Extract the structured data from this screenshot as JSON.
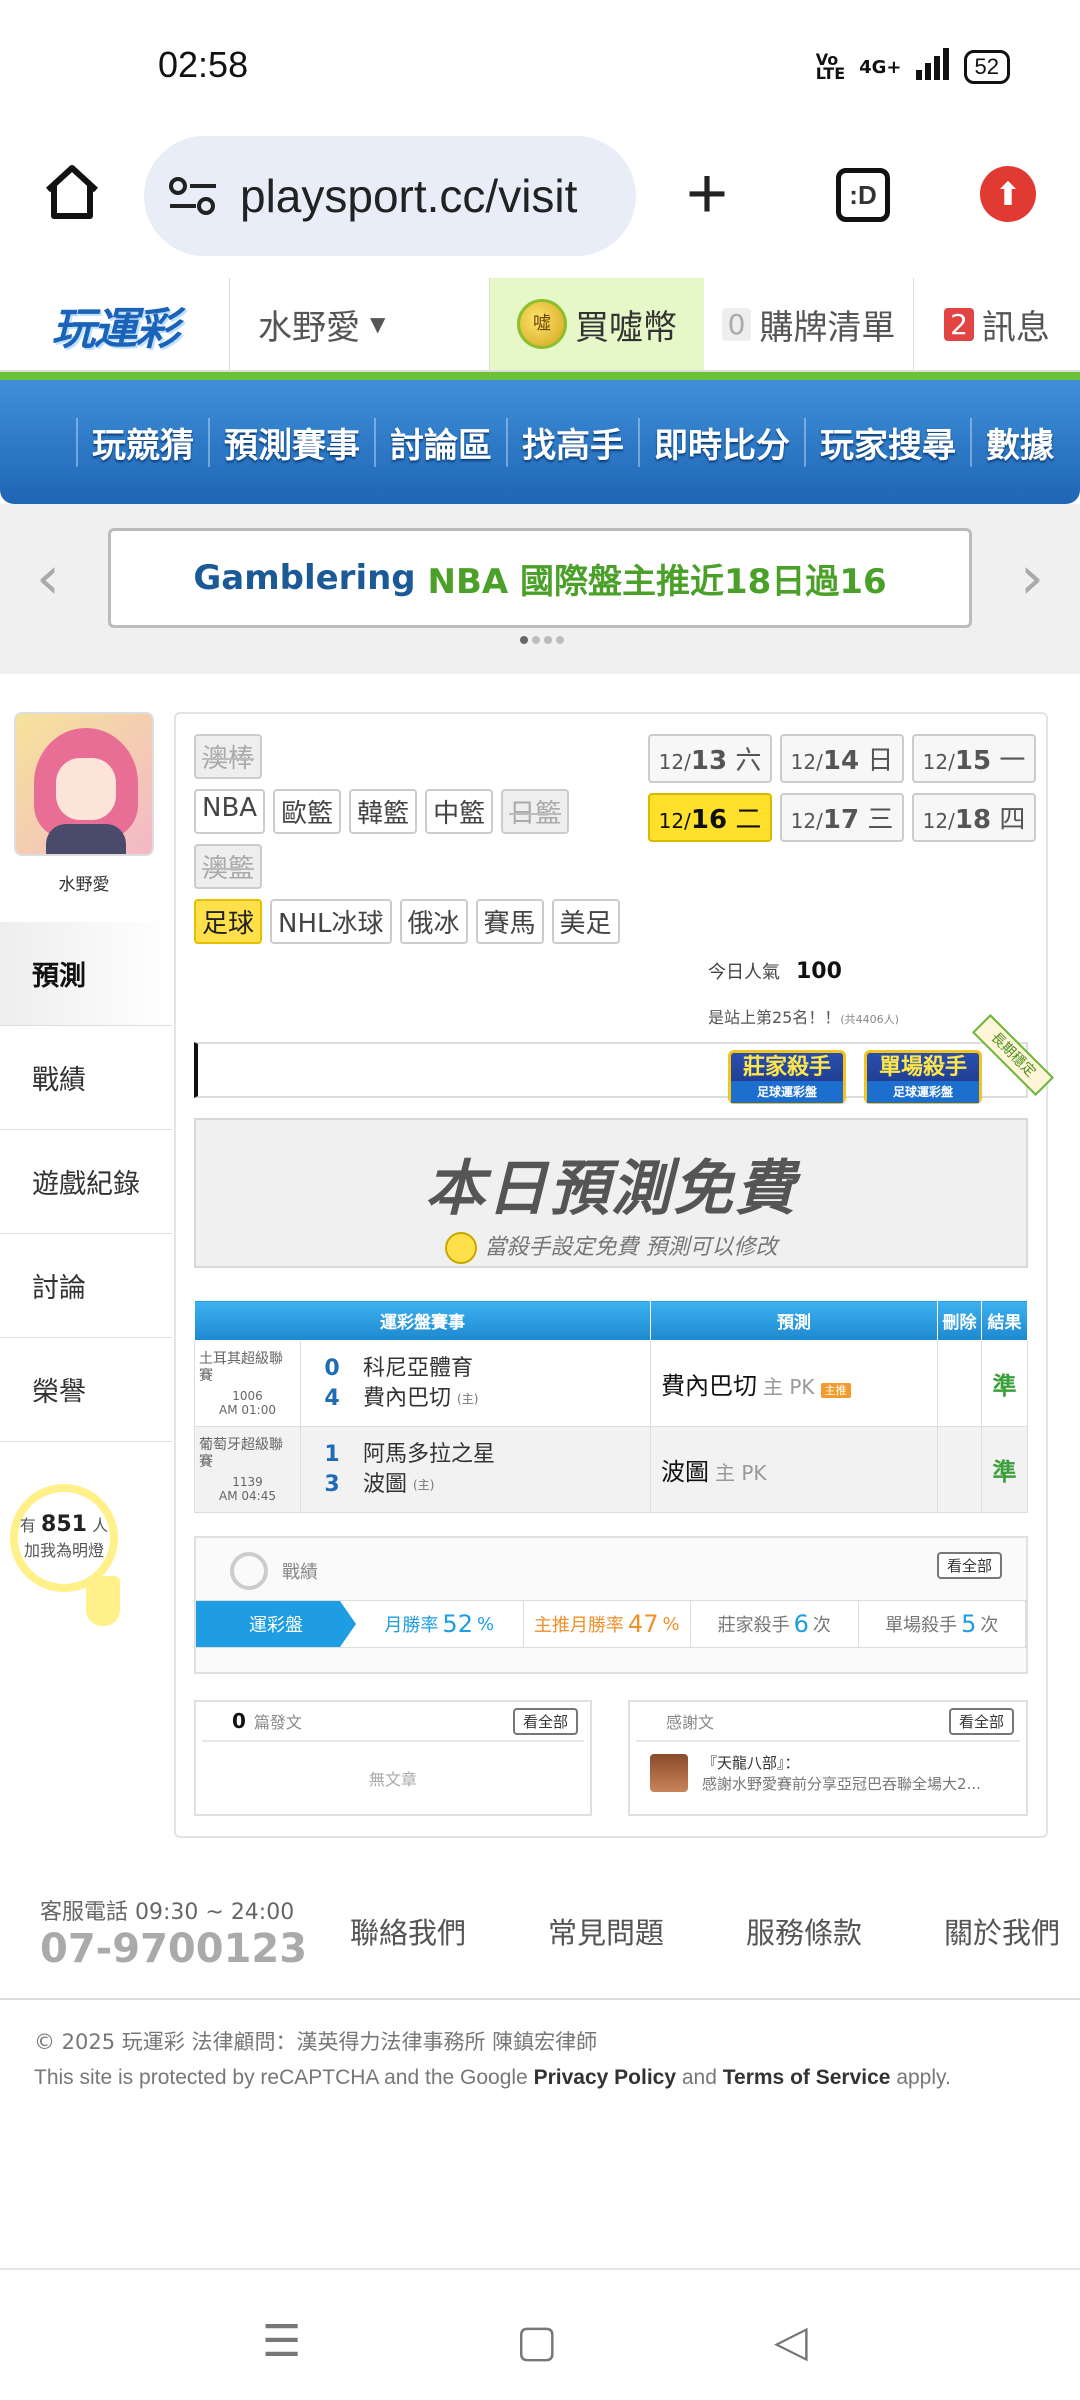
{
  "status": {
    "time": "02:58",
    "network": "4G+",
    "battery": "52"
  },
  "browser": {
    "url": "playsport.cc/visit",
    "tabs_label": ":D"
  },
  "header": {
    "logo": "玩運彩",
    "username": "水野愛",
    "buy_coin": "買噓幣",
    "cart_count": "0",
    "cart_label": "購牌清單",
    "msg_count": "2",
    "msg_label": "訊息"
  },
  "nav": [
    "玩競猜",
    "預測賽事",
    "討論區",
    "找高手",
    "即時比分",
    "玩家搜尋",
    "數據"
  ],
  "banner": {
    "part1": "Gamblering",
    "part2": "NBA 國際盤主推近18日過16"
  },
  "profile": {
    "name": "水野愛",
    "menu": [
      "預測",
      "戰績",
      "遊戲紀錄",
      "討論",
      "榮譽"
    ],
    "fans_prefix": "有",
    "fans_count": "851",
    "fans_suffix": "人",
    "fans_note": "加我為明燈"
  },
  "sports": {
    "row1": [
      {
        "label": "澳棒",
        "state": "off"
      }
    ],
    "row2": [
      {
        "label": "NBA",
        "state": "on"
      },
      {
        "label": "歐籃",
        "state": "on"
      },
      {
        "label": "韓籃",
        "state": "on"
      },
      {
        "label": "中籃",
        "state": "on"
      },
      {
        "label": "日籃",
        "state": "off"
      }
    ],
    "row3": [
      {
        "label": "澳籃",
        "state": "off"
      }
    ],
    "row4": [
      {
        "label": "足球",
        "state": "selected"
      },
      {
        "label": "NHL冰球",
        "state": "on"
      },
      {
        "label": "俄冰",
        "state": "on"
      },
      {
        "label": "賽馬",
        "state": "on"
      },
      {
        "label": "美足",
        "state": "on"
      }
    ]
  },
  "dates": [
    {
      "m": "12/",
      "d": "13",
      "w": "六"
    },
    {
      "m": "12/",
      "d": "14",
      "w": "日"
    },
    {
      "m": "12/",
      "d": "15",
      "w": "一"
    },
    {
      "m": "12/",
      "d": "16",
      "w": "二",
      "selected": true
    },
    {
      "m": "12/",
      "d": "17",
      "w": "三"
    },
    {
      "m": "12/",
      "d": "18",
      "w": "四"
    }
  ],
  "popularity": {
    "label": "今日人氣",
    "value": "100",
    "rank": "是站上第25名！！",
    "rank_total": "(共4406人)"
  },
  "badges": [
    {
      "title": "莊家殺手",
      "sub": "足球運彩盤"
    },
    {
      "title": "單場殺手",
      "sub": "足球運彩盤"
    }
  ],
  "sash": "長期穩定",
  "free": {
    "title": "本日預測免費",
    "sub": "當殺手設定免費  預測可以修改"
  },
  "table": {
    "headers": [
      "運彩盤賽事",
      "預測",
      "刪除",
      "結果"
    ],
    "rows": [
      {
        "league": "土耳其超級聯賽",
        "code": "1006",
        "time": "AM 01:00",
        "away_score": "0",
        "away": "科尼亞體育",
        "home_score": "4",
        "home": "費內巴切",
        "home_mark": "(主)",
        "pick": "費內巴切",
        "pick_type": "主 PK",
        "pick_tag": "主推",
        "result": "準"
      },
      {
        "league": "葡萄牙超級聯賽",
        "code": "1139",
        "time": "AM 04:45",
        "away_score": "1",
        "away": "阿馬多拉之星",
        "home_score": "3",
        "home": "波圖",
        "home_mark": "(主)",
        "pick": "波圖",
        "pick_type": "主 PK",
        "pick_tag": "",
        "result": "準"
      }
    ]
  },
  "record": {
    "title": "戰績",
    "view_all": "看全部",
    "label": "運彩盤",
    "stats": [
      {
        "name": "月勝率",
        "value": "52",
        "unit": "%"
      },
      {
        "name": "主推月勝率",
        "value": "47",
        "unit": "%"
      },
      {
        "name": "莊家殺手",
        "value": "6",
        "unit": "次"
      },
      {
        "name": "單場殺手",
        "value": "5",
        "unit": "次"
      }
    ]
  },
  "posts": {
    "count": "0",
    "label": "篇發文",
    "view_all": "看全部",
    "empty": "無文章"
  },
  "thanks": {
    "label": "感謝文",
    "view_all": "看全部",
    "title": "『天龍八部』：",
    "text": "感謝水野愛賽前分享亞冠巴吞聯全場大2..."
  },
  "footer": {
    "hotline": "客服電話 09:30 ~ 24:00",
    "phone": "07-9700123",
    "links": [
      "聯絡我們",
      "常見問題",
      "服務條款",
      "關於我們"
    ],
    "copyright": "© 2025 玩運彩 法律顧問：漢英得力法律事務所 陳鎮宏律師",
    "recaptcha_pre": "This site is protected by reCAPTCHA and the Google",
    "privacy": "Privacy Policy",
    "and": "and",
    "terms": "Terms of Service",
    "apply": "apply."
  }
}
